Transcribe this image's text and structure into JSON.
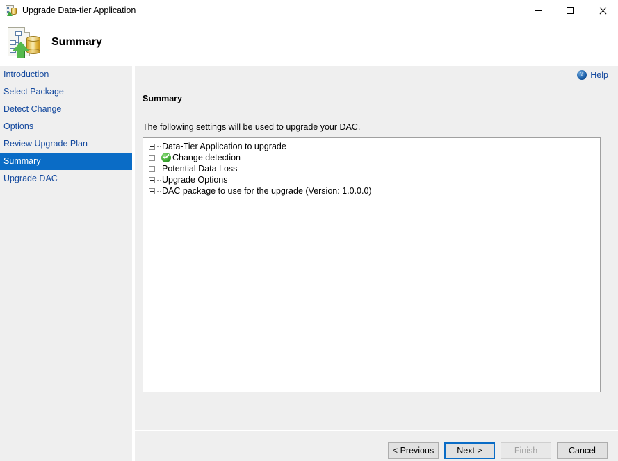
{
  "window": {
    "title": "Upgrade Data-tier Application",
    "title_icon": "dac-upgrade-icon",
    "controls": {
      "minimize": "minimize-icon",
      "maximize": "maximize-icon",
      "close": "close-icon"
    }
  },
  "banner": {
    "title": "Summary",
    "icon": "dac-upgrade-large-icon"
  },
  "sidebar": {
    "items": [
      {
        "label": "Introduction",
        "selected": false
      },
      {
        "label": "Select Package",
        "selected": false
      },
      {
        "label": "Detect Change",
        "selected": false
      },
      {
        "label": "Options",
        "selected": false
      },
      {
        "label": "Review Upgrade Plan",
        "selected": false
      },
      {
        "label": "Summary",
        "selected": true
      },
      {
        "label": "Upgrade DAC",
        "selected": false
      }
    ],
    "selected_bg": "#0a6cc6",
    "link_color": "#14499e"
  },
  "main": {
    "help": {
      "label": "Help",
      "icon": "help-circle-icon"
    },
    "section_title": "Summary",
    "description": "The following settings will be used to upgrade your DAC.",
    "tree": {
      "nodes": [
        {
          "label": "Data-Tier Application to upgrade",
          "expandable": true,
          "status_icon": null
        },
        {
          "label": "Change detection",
          "expandable": true,
          "status_icon": "success-check-icon"
        },
        {
          "label": "Potential Data Loss",
          "expandable": true,
          "status_icon": null
        },
        {
          "label": "Upgrade Options",
          "expandable": true,
          "status_icon": null
        },
        {
          "label": "DAC package to use for the upgrade (Version:  1.0.0.0)",
          "expandable": true,
          "status_icon": null
        }
      ]
    }
  },
  "footer": {
    "buttons": [
      {
        "label": "< Previous",
        "state": "enabled"
      },
      {
        "label": "Next >",
        "state": "default"
      },
      {
        "label": "Finish",
        "state": "disabled"
      },
      {
        "label": "Cancel",
        "state": "enabled"
      }
    ]
  }
}
